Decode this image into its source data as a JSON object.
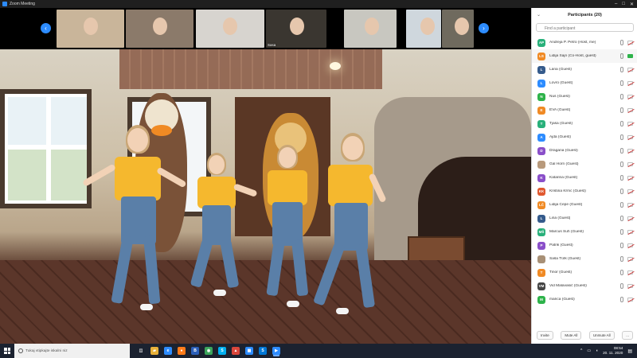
{
  "window": {
    "title": "Zoom Meeting"
  },
  "thumbnails": [
    {
      "label": "",
      "bg": "#c9b59a"
    },
    {
      "label": "",
      "bg": "#8b7a6a"
    },
    {
      "label": "",
      "bg": "#d7d4cf"
    },
    {
      "label": "Sasa",
      "bg": "#3a3630"
    },
    {
      "label": "",
      "bg": "#c8c7c0"
    },
    {
      "label": "",
      "bg": "#cfd7dd"
    },
    {
      "label": "",
      "bg": "#6f6a5e"
    }
  ],
  "participants_panel": {
    "title": "Participants (20)",
    "search_placeholder": "Find a participant",
    "participants": [
      {
        "initials": "AP",
        "name": "Andreja P. Petro (Host, me)",
        "color": "#28b07a"
      },
      {
        "initials": "LS",
        "name": "Lidija Sajn (Co-Host, guest)",
        "color": "#f08a24"
      },
      {
        "initials": "L",
        "name": "Lana (Guest)",
        "color": "#355b8c"
      },
      {
        "initials": "L",
        "name": "Lovro (Guest)",
        "color": "#2d8cff"
      },
      {
        "initials": "N",
        "name": "Nus (Guest)",
        "color": "#2eb34a"
      },
      {
        "initials": "E",
        "name": "EVA (Guest)",
        "color": "#f08a24"
      },
      {
        "initials": "T",
        "name": "Tjasa (Guest)",
        "color": "#28b07a"
      },
      {
        "initials": "A",
        "name": "Ajda (Guest)",
        "color": "#2d8cff"
      },
      {
        "initials": "D",
        "name": "Dragana (Guest)",
        "color": "#8a4fc9"
      },
      {
        "initials": "",
        "name": "Gal Horn (Guest)",
        "color": "#b89a7c"
      },
      {
        "initials": "K",
        "name": "Katarina (Guest)",
        "color": "#8a4fc9"
      },
      {
        "initials": "KK",
        "name": "Kristina Krmc (Guest)",
        "color": "#e0582f"
      },
      {
        "initials": "LČ",
        "name": "Lidija Čepe (Guest)",
        "color": "#f08a24"
      },
      {
        "initials": "L",
        "name": "Lina (Guest)",
        "color": "#355b8c"
      },
      {
        "initials": "MŠ",
        "name": "Marcus Šuh (Guest)",
        "color": "#28b07a"
      },
      {
        "initials": "P",
        "name": "Patrik (Guest)",
        "color": "#8a4fc9"
      },
      {
        "initials": "",
        "name": "Saša Türk (Guest)",
        "color": "#a89076"
      },
      {
        "initials": "T",
        "name": "Tinor (Guest)",
        "color": "#f08a24"
      },
      {
        "initials": "VM",
        "name": "Vid Malavasič (Guest)",
        "color": "#444444"
      },
      {
        "initials": "M",
        "name": "marica (Guest)",
        "color": "#2eb34a"
      }
    ],
    "footer": {
      "invite": "Invite",
      "mute_all": "Mute All",
      "unmute_all": "Unmute All",
      "more": "..."
    }
  },
  "taskbar": {
    "search_placeholder": "Tukaj vtipkajte iskalni niz",
    "time": "08:54",
    "date": "20. 11. 2020",
    "apps": [
      {
        "name": "task-view-icon",
        "glyph": "◫",
        "color": "#1b2230"
      },
      {
        "name": "file-explorer-icon",
        "glyph": "▰",
        "color": "#e8b13a"
      },
      {
        "name": "edge-icon",
        "glyph": "e",
        "color": "#2d8cff"
      },
      {
        "name": "firefox-icon",
        "glyph": "●",
        "color": "#ff7b1a"
      },
      {
        "name": "b-app-icon",
        "glyph": "B",
        "color": "#2b5fb8"
      },
      {
        "name": "chrome-icon",
        "glyph": "◉",
        "color": "#3ba55c"
      },
      {
        "name": "skype-icon",
        "glyph": "S",
        "color": "#00aff0"
      },
      {
        "name": "paint-icon",
        "glyph": "▲",
        "color": "#d9463b"
      },
      {
        "name": "photos-icon",
        "glyph": "▦",
        "color": "#2d8cff"
      },
      {
        "name": "skype2-icon",
        "glyph": "S",
        "color": "#0078d7"
      },
      {
        "name": "zoom-icon",
        "glyph": "▶",
        "color": "#2d8cff"
      }
    ]
  }
}
